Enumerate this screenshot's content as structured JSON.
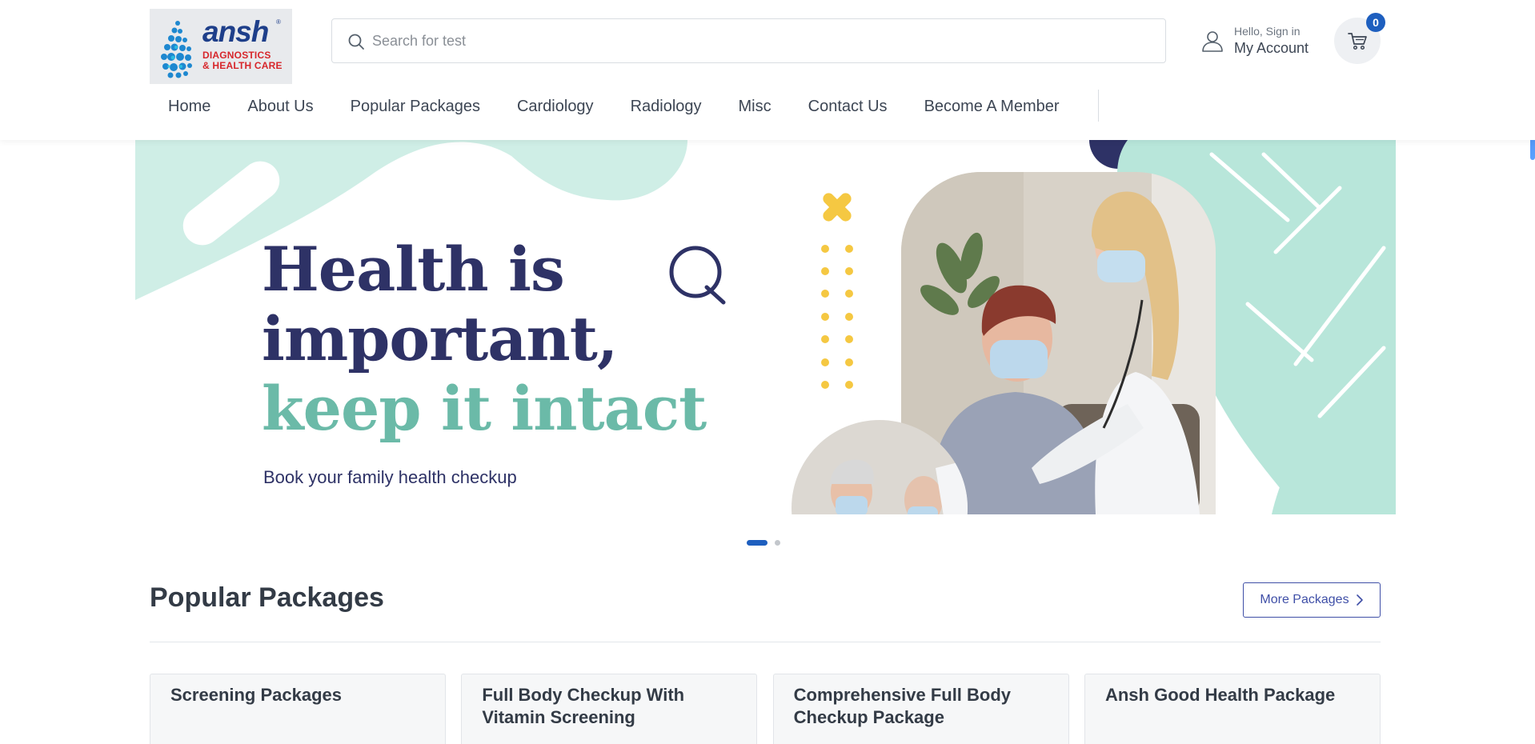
{
  "brand": {
    "name": "ansh",
    "registered_mark": "®",
    "tagline_line1": "DIAGNOSTICS",
    "tagline_line2": "& HEALTH CARE",
    "colors": {
      "primary": "#1e3f8a",
      "accent": "#d7262b",
      "drop_blue": "#2aa8e0"
    }
  },
  "search": {
    "placeholder": "Search for test",
    "value": "",
    "icon": "search-icon"
  },
  "account": {
    "greeting": "Hello, Sign in",
    "label": "My Account",
    "icon": "user-icon"
  },
  "cart": {
    "count": "0",
    "icon": "cart-icon"
  },
  "nav": {
    "items": [
      {
        "label": "Home"
      },
      {
        "label": "About Us"
      },
      {
        "label": "Popular Packages"
      },
      {
        "label": "Cardiology"
      },
      {
        "label": "Radiology"
      },
      {
        "label": "Misc"
      },
      {
        "label": "Contact Us"
      },
      {
        "label": "Become A Member"
      }
    ]
  },
  "hero": {
    "line1": "Health is",
    "line2": "important,",
    "line3": "keep it intact",
    "subtitle": "Book your family health checkup",
    "colors": {
      "navy": "#2e3266",
      "teal": "#6bbaa8",
      "mint": "#cfeee6",
      "yellow": "#f5c842"
    },
    "slides": 2,
    "active_slide": 1
  },
  "packages": {
    "title": "Popular Packages",
    "more_label": "More Packages",
    "items": [
      {
        "title": "Screening Packages"
      },
      {
        "title": "Full Body Checkup With Vitamin Screening"
      },
      {
        "title": "Comprehensive Full Body Checkup Package"
      },
      {
        "title": "Ansh Good Health Package"
      }
    ]
  },
  "theme": {
    "link_blue": "#1e5fbf",
    "button_indigo": "#3f4fa7",
    "text_dark": "#333b46"
  }
}
